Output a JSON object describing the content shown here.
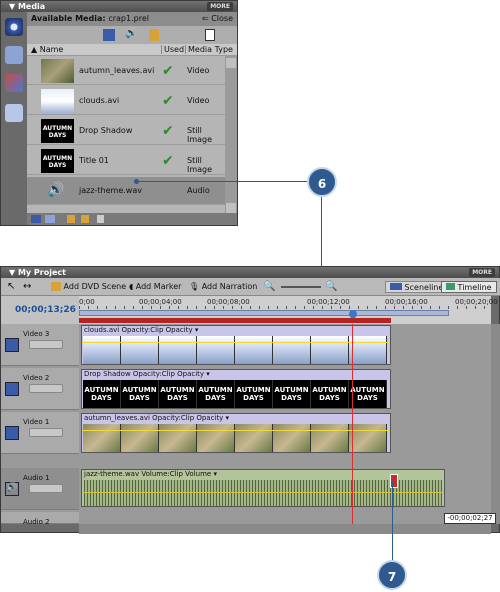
{
  "media_panel": {
    "title": "Media",
    "more": "MORE",
    "available_label": "Available Media:",
    "available_file": "crap1.prel",
    "close": "Close",
    "columns": {
      "name": "Name",
      "used": "Used",
      "type": "Media Type"
    },
    "items": [
      {
        "name": "autumn_leaves.avi",
        "used": "✔",
        "type": "Video",
        "thumb": "leaves"
      },
      {
        "name": "clouds.avi",
        "used": "✔",
        "type": "Video",
        "thumb": "clouds"
      },
      {
        "name": "Drop Shadow",
        "used": "✔",
        "type": "Still Image",
        "thumb": "autumn"
      },
      {
        "name": "Title 01",
        "used": "✔",
        "type": "Still Image",
        "thumb": "autumn"
      },
      {
        "name": "jazz-theme.wav",
        "used": "",
        "type": "Audio",
        "thumb": "speaker"
      }
    ]
  },
  "project_panel": {
    "title": "My Project",
    "more": "MORE",
    "toolbar": {
      "add_dvd_scene": "Add DVD Scene",
      "add_marker": "Add Marker",
      "add_narration": "Add Narration",
      "sceneline": "Sceneline",
      "timeline": "Timeline"
    },
    "timecode": "00;00;13;26",
    "ruler": [
      "0;00",
      "00;00;04;00",
      "00;00;08;00",
      "00;00;12;00",
      "00;00;16;00",
      "00;00;20;00"
    ],
    "tracks": [
      {
        "name": "Video 3",
        "clip": "clouds.avi",
        "effect": "Opacity:Clip Opacity"
      },
      {
        "name": "Video 2",
        "clip": "Drop Shadow",
        "effect": "Opacity:Clip Opacity"
      },
      {
        "name": "Video 1",
        "clip": "autumn_leaves.avi",
        "effect": "Opacity:Clip Opacity"
      },
      {
        "name": "Audio 1",
        "clip": "jazz-theme.wav",
        "effect": "Volume:Clip Volume"
      },
      {
        "name": "Audio 2",
        "clip": "",
        "effect": ""
      }
    ],
    "trim_readout": "-00;00;02;27"
  },
  "frame_text": "AUTUMN\nDAYS",
  "callouts": [
    "6",
    "7"
  ],
  "colors": {
    "callout": "#2e5a8f",
    "playhead": "#d83030",
    "timecode": "#1c4f9a"
  }
}
